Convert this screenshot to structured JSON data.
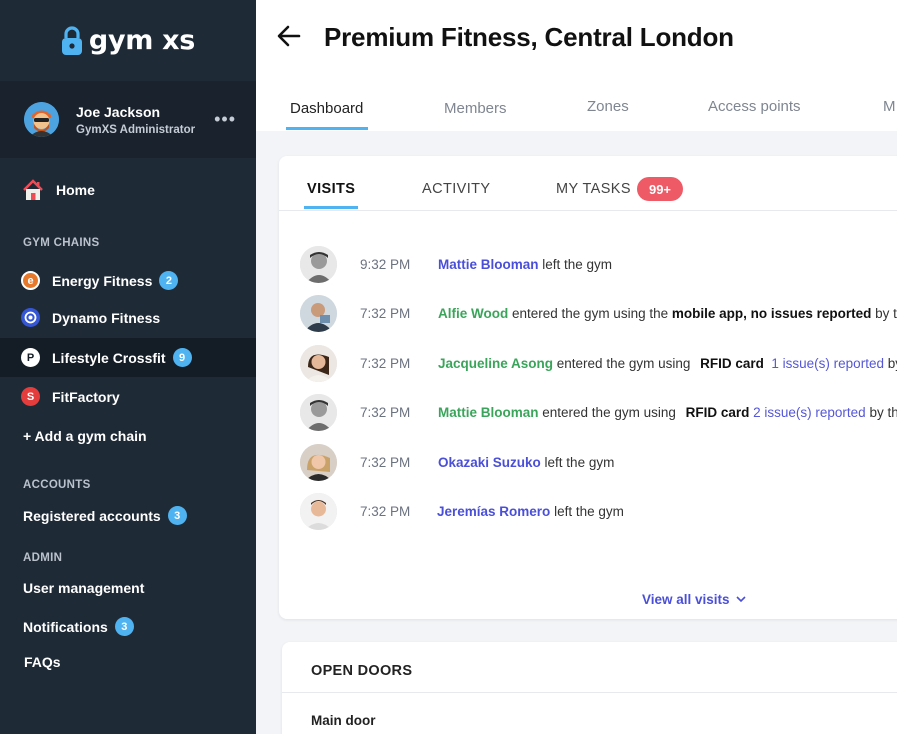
{
  "app": {
    "logo_text": "gym xs"
  },
  "profile": {
    "name": "Joe Jackson",
    "role": "GymXS Administrator",
    "more": "•••"
  },
  "sidebar": {
    "home_label": "Home",
    "gym_chains_label": "GYM CHAINS",
    "chains": [
      {
        "label": "Energy Fitness",
        "badge": "2",
        "icon_letter": "e",
        "color": "#e6782b"
      },
      {
        "label": "Dynamo Fitness",
        "badge": "",
        "icon_letter": "",
        "color": "#3557d6"
      },
      {
        "label": "Lifestyle Crossfit",
        "badge": "9",
        "icon_letter": "P",
        "color": "#ffffff"
      },
      {
        "label": "FitFactory",
        "badge": "",
        "icon_letter": "S",
        "color": "#e43d3d"
      }
    ],
    "add_chain_label": "+ Add a gym chain",
    "accounts_label": "ACCOUNTS",
    "registered_accounts": {
      "label": "Registered accounts",
      "badge": "3"
    },
    "admin_label": "ADMIN",
    "user_management": "User management",
    "notifications": {
      "label": "Notifications",
      "badge": "3"
    },
    "faqs": "FAQs"
  },
  "header": {
    "title": "Premium Fitness, Central London",
    "tabs": [
      "Dashboard",
      "Members",
      "Zones",
      "Access points",
      "M"
    ]
  },
  "visits": {
    "tabs": [
      "VISITS",
      "ACTIVITY",
      "MY TASKS"
    ],
    "tasks_badge": "99+",
    "rows": [
      {
        "time": "9:32 PM",
        "name": "Mattie Blooman",
        "name_color": "blue",
        "text": " left the gym"
      },
      {
        "time": "7:32 PM",
        "name": "Alfie Wood",
        "name_color": "green",
        "text": " entered the gym using the ",
        "bold": "mobile app, no issues reported",
        "tail": " by the"
      },
      {
        "time": "7:32 PM",
        "name": "Jacqueline Asong",
        "name_color": "green",
        "text": " entered the gym using ",
        "bold": "RFID card",
        "issue": "1 issue(s) reported",
        "tail": " by"
      },
      {
        "time": "7:32 PM",
        "name": "Mattie Blooman",
        "name_color": "green",
        "text": " entered the gym using ",
        "bold": "RFID card",
        "issue": "2 issue(s) reported",
        "tail": " by th"
      },
      {
        "time": "7:32 PM",
        "name": "Okazaki Suzuko",
        "name_color": "blue",
        "text": " left the gym"
      },
      {
        "time": "7:32 PM",
        "name": "Jeremías Romero",
        "name_color": "blue",
        "text": " left the gym"
      }
    ],
    "view_all": "View all visits"
  },
  "open_doors": {
    "title": "OPEN DOORS",
    "first_door": "Main door"
  }
}
